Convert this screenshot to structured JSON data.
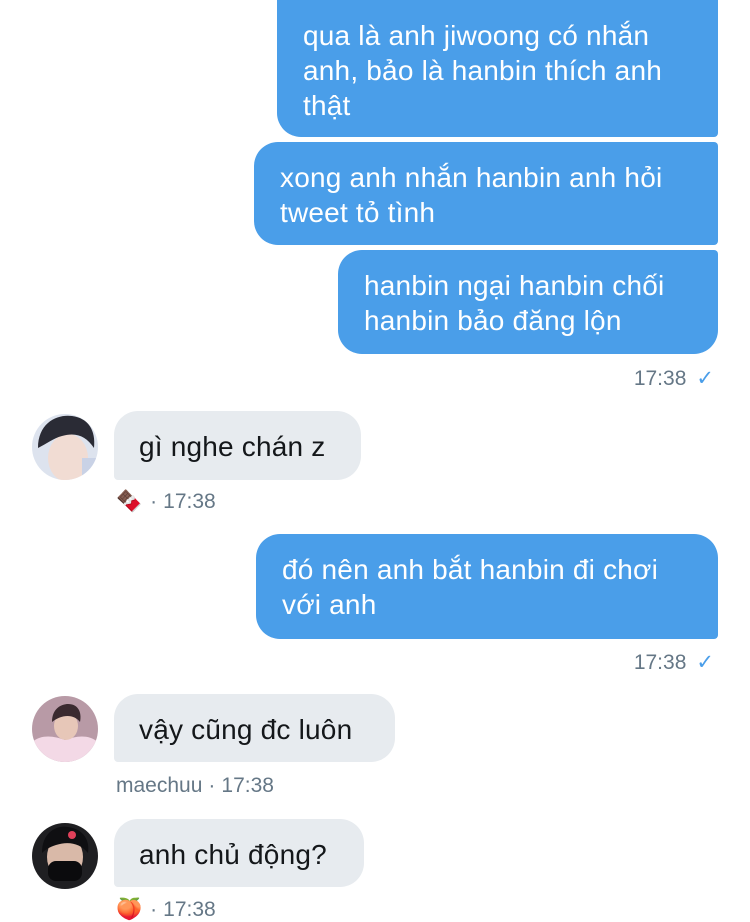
{
  "messages": {
    "m1": {
      "lines": [
        "qua là anh jiwoong có nhắn",
        "anh, bảo là hanbin thích anh",
        "thật"
      ]
    },
    "m2": {
      "lines": [
        "xong anh nhắn hanbin anh hỏi",
        "tweet tỏ tình"
      ]
    },
    "m3": {
      "lines": [
        "hanbin ngại hanbin chối",
        "hanbin bảo đăng lộn"
      ],
      "time": "17:38",
      "status_icon": "✓"
    },
    "m4": {
      "text": "gì nghe chán z",
      "sender_label": "🍫",
      "separator": "·",
      "time": "17:38"
    },
    "m5": {
      "lines": [
        "đó nên anh bắt hanbin đi chơi",
        "với anh"
      ],
      "time": "17:38",
      "status_icon": "✓"
    },
    "m6": {
      "text": "vậy cũng đc luôn",
      "sender_label": "maechuu",
      "separator": "·",
      "time": "17:38"
    },
    "m7": {
      "text": "anh chủ động?",
      "sender_label": "🍑",
      "separator": "·",
      "time": "17:38"
    }
  },
  "colors": {
    "outgoing_bubble": "#4a9ee9",
    "incoming_bubble": "#e7ebef",
    "meta_text": "#657786",
    "read_check": "#4a9ee9"
  },
  "icons": {
    "read_receipt": "check-icon",
    "avatar_1": "user-avatar-icon",
    "avatar_2": "user-avatar-icon",
    "avatar_3": "user-avatar-icon"
  }
}
